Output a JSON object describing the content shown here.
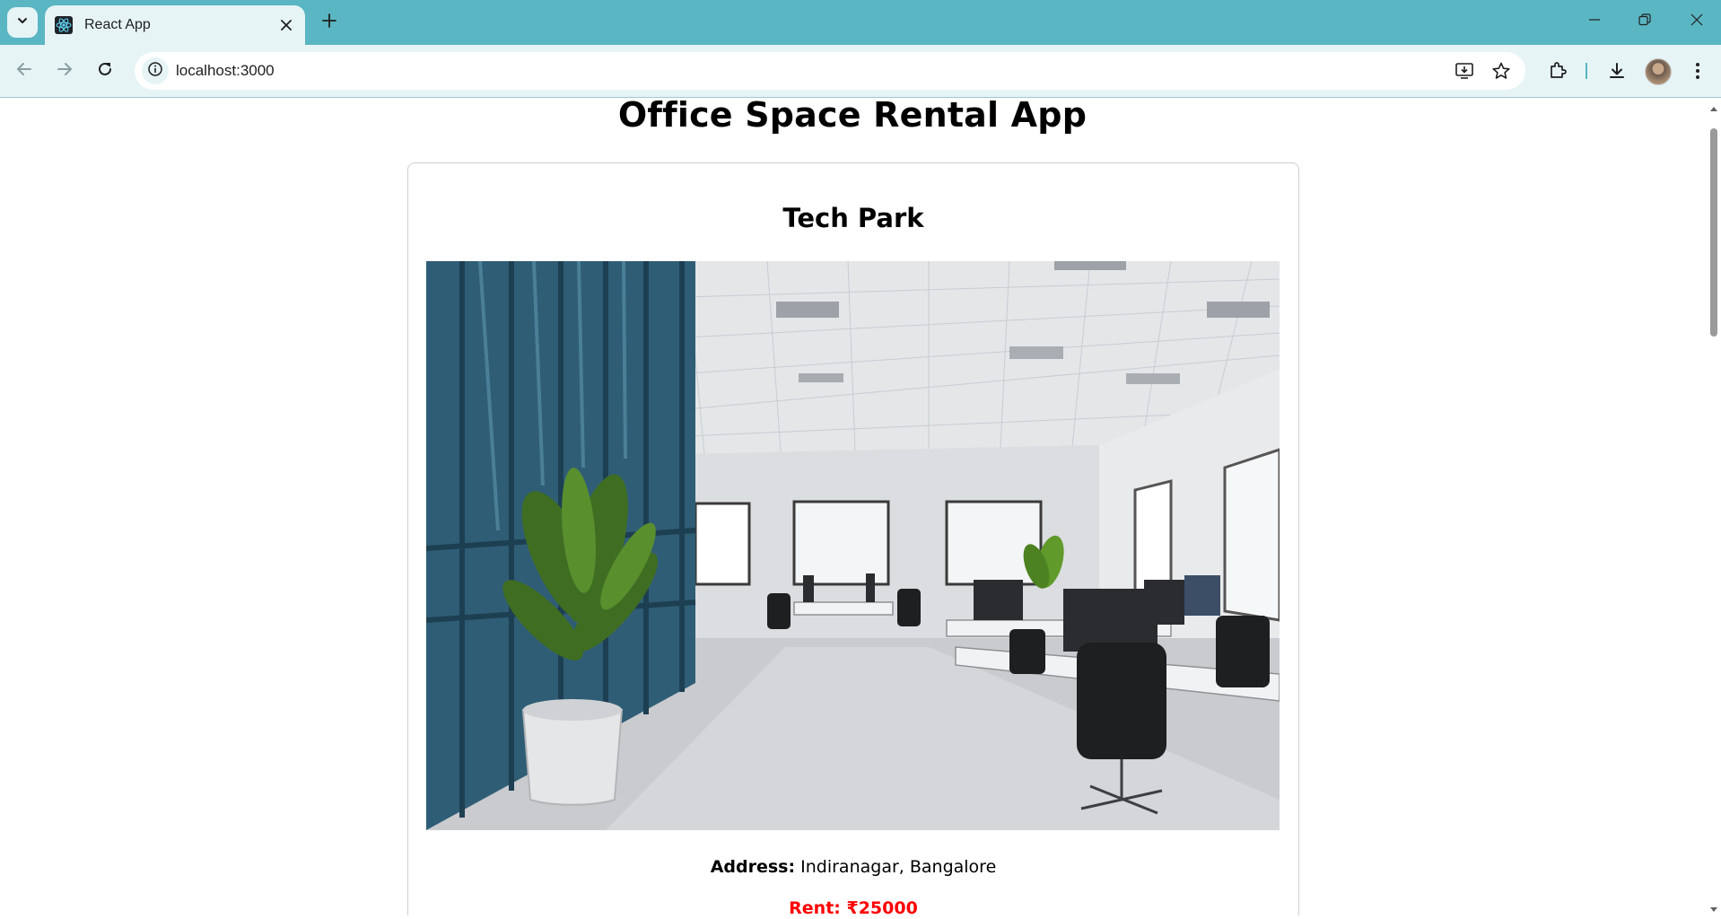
{
  "browser": {
    "tab": {
      "title": "React App"
    },
    "address_bar": {
      "url": "localhost:3000"
    }
  },
  "page": {
    "heading": "Office Space Rental App",
    "listing": {
      "name": "Tech Park",
      "address_label": "Address:",
      "address_value": "Indiranagar, Bangalore",
      "rent_text": "Rent: ₹25000",
      "rent_color": "#ff0000"
    }
  },
  "colors": {
    "tabbar": "#5ab6c2",
    "toolbar": "#e6f4f6",
    "accent_wall": "#2f5d75"
  },
  "icons": [
    "tab-search-icon",
    "react-icon",
    "close-icon",
    "plus-icon",
    "minimize-icon",
    "restore-icon",
    "back-icon",
    "forward-icon",
    "reload-icon",
    "site-info-icon",
    "install-icon",
    "star-icon",
    "extensions-icon",
    "download-icon",
    "menu-icon"
  ]
}
